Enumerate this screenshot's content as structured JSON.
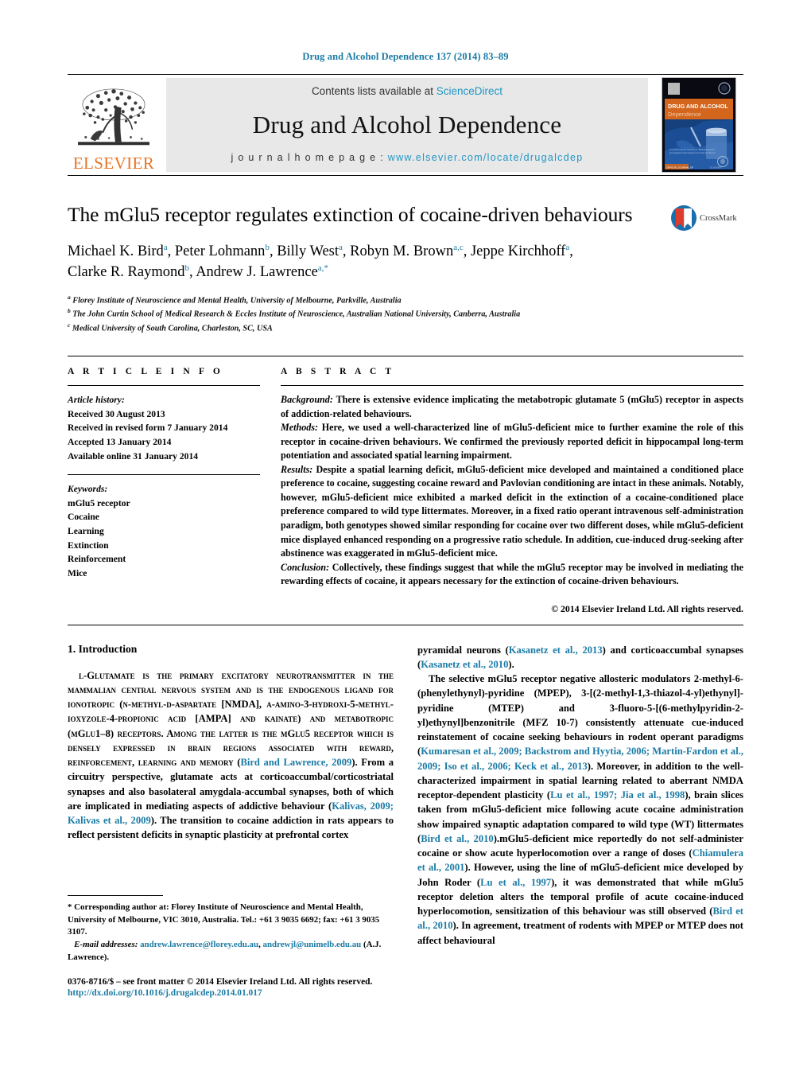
{
  "running_head": "Drug and Alcohol Dependence 137 (2014) 83–89",
  "masthead": {
    "elsevier_label": "ELSEVIER",
    "contents_prefix": "Contents lists available at ",
    "contents_link": "ScienceDirect",
    "journal_name": "Drug and Alcohol Dependence",
    "homepage_prefix": "j o u r n a l   h o m e p a g e :   ",
    "homepage_url": "www.elsevier.com/locate/drugalcdep",
    "cover_title_line1": "DRUG AND ALCOHOL",
    "cover_title_line2": "Dependence"
  },
  "article": {
    "title": "The mGlu5 receptor regulates extinction of cocaine-driven behaviours",
    "crossmark_label": "CrossMark",
    "authors_line1": "Michael K. Bird a, Peter Lohmann b, Billy West a, Robyn M. Brown a,c, Jeppe Kirchhoff a,",
    "authors_line2": "Clarke R. Raymond b, Andrew J. Lawrence a,*",
    "affiliations": [
      {
        "marker": "a",
        "text": "Florey Institute of Neuroscience and Mental Health, University of Melbourne, Parkville, Australia"
      },
      {
        "marker": "b",
        "text": "The John Curtin School of Medical Research & Eccles Institute of Neuroscience, Australian National University, Canberra, Australia"
      },
      {
        "marker": "c",
        "text": "Medical University of South Carolina, Charleston, SC, USA"
      }
    ]
  },
  "article_info": {
    "heading": "A R T I C L E   I N F O",
    "history_label": "Article history:",
    "history": [
      "Received 30 August 2013",
      "Received in revised form 7 January 2014",
      "Accepted 13 January 2014",
      "Available online 31 January 2014"
    ],
    "keywords_label": "Keywords:",
    "keywords": [
      "mGlu5 receptor",
      "Cocaine",
      "Learning",
      "Extinction",
      "Reinforcement",
      "Mice"
    ]
  },
  "abstract": {
    "heading": "A B S T R A C T",
    "background_label": "Background:",
    "background_text": " There is extensive evidence implicating the metabotropic glutamate 5 (mGlu5) receptor in aspects of addiction-related behaviours.",
    "methods_label": "Methods:",
    "methods_text": " Here, we used a well-characterized line of mGlu5-deficient mice to further examine the role of this receptor in cocaine-driven behaviours. We confirmed the previously reported deficit in hippocampal long-term potentiation and associated spatial learning impairment.",
    "results_label": "Results:",
    "results_text": " Despite a spatial learning deficit, mGlu5-deficient mice developed and maintained a conditioned place preference to cocaine, suggesting cocaine reward and Pavlovian conditioning are intact in these animals. Notably, however, mGlu5-deficient mice exhibited a marked deficit in the extinction of a cocaine-conditioned place preference compared to wild type littermates. Moreover, in a fixed ratio operant intravenous self-administration paradigm, both genotypes showed similar responding for cocaine over two different doses, while mGlu5-deficient mice displayed enhanced responding on a progressive ratio schedule. In addition, cue-induced drug-seeking after abstinence was exaggerated in mGlu5-deficient mice.",
    "conclusion_label": "Conclusion:",
    "conclusion_text": " Collectively, these findings suggest that while the mGlu5 receptor may be involved in mediating the rewarding effects of cocaine, it appears necessary for the extinction of cocaine-driven behaviours.",
    "copyright": "© 2014 Elsevier Ireland Ltd. All rights reserved."
  },
  "introduction": {
    "heading": "1.  Introduction",
    "para1_a": "l-Glutamate is the primary excitatory neurotransmitter in the mammalian central nervous system and is the endogenous ligand for ionotropic (n-methyl-d-aspartate [NMDA], α-amino-3-hydroxi-5-methyl-ioxyzole-4-propionic acid [AMPA] and kainate) and metabotropic (mGlu1–8) receptors. Among the latter is the mGlu5 receptor which is densely expressed in brain regions associated with reward, reinforcement, learning and memory (",
    "para1_cite1": "Bird and Lawrence, 2009",
    "para1_b": "). From a circuitry perspective, glutamate acts at corticoaccumbal/corticostriatal synapses and also basolateral amygdala-accumbal synapses, both of which are implicated in mediating aspects of addictive behaviour (",
    "para1_cite2": "Kalivas, 2009; Kalivas et al., 2009",
    "para1_c": "). The transition to cocaine addiction in rats appears to reflect persistent deficits in synaptic plasticity at prefrontal cortex ",
    "para1_d": "pyramidal neurons (",
    "para1_cite3": "Kasanetz et al., 2013",
    "para1_e": ") and corticoaccumbal synapses (",
    "para1_cite4": "Kasanetz et al., 2010",
    "para1_f": ").",
    "para2_a": "The selective mGlu5 receptor negative allosteric modulators 2-methyl-6-(phenylethynyl)-pyridine (MPEP), 3-[(2-methyl-1,3-thiazol-4-yl)ethynyl]-pyridine (MTEP) and 3-fluoro-5-[(6-methylpyridin-2-yl)ethynyl]benzonitrile (MFZ 10-7) consistently attenuate cue-induced reinstatement of cocaine seeking behaviours in rodent operant paradigms (",
    "para2_cite1": "Kumaresan et al., 2009; Backstrom and Hyytia, 2006; Martin-Fardon et al., 2009; Iso et al., 2006; Keck et al., 2013",
    "para2_b": "). Moreover, in addition to the well-characterized impairment in spatial learning related to aberrant NMDA receptor-dependent plasticity (",
    "para2_cite2": "Lu et al., 1997; Jia et al., 1998",
    "para2_c": "), brain slices taken from mGlu5-deficient mice following acute cocaine administration show impaired synaptic adaptation compared to wild type (WT) littermates (",
    "para2_cite3": "Bird et al., 2010",
    "para2_d": ").mGlu5-deficient mice reportedly do not self-administer cocaine or show acute hyperlocomotion over a range of doses (",
    "para2_cite4": "Chiamulera et al., 2001",
    "para2_e": "). However, using the line of mGlu5-deficient mice developed by John Roder (",
    "para2_cite5": "Lu et al., 1997",
    "para2_f": "), it was demonstrated that while mGlu5 receptor deletion alters the temporal profile of acute cocaine-induced hyperlocomotion, sensitization of this behaviour was still observed (",
    "para2_cite6": "Bird et al., 2010",
    "para2_g": "). In agreement, treatment of rodents with MPEP or MTEP does not affect behavioural"
  },
  "footnote": {
    "corresponding": "*  Corresponding author at: Florey Institute of Neuroscience and Mental Health, University of Melbourne, VIC 3010, Australia. Tel.: +61 3 9035 6692; fax: +61 3 9035 3107.",
    "email_label": "E-mail addresses:",
    "email1": "andrew.lawrence@florey.edu.au",
    "email2": "andrewjl@unimelb.edu.au",
    "email_suffix": " (A.J. Lawrence).",
    "issn": "0376-8716/$ – see front matter © 2014 Elsevier Ireland Ltd. All rights reserved.",
    "doi": "http://dx.doi.org/10.1016/j.drugalcdep.2014.01.017"
  },
  "colors": {
    "link_blue": "#1b7ba5",
    "sciencedirect_blue": "#2196c4",
    "elsevier_orange": "#e87424",
    "band_gray": "#e8e8e8"
  }
}
